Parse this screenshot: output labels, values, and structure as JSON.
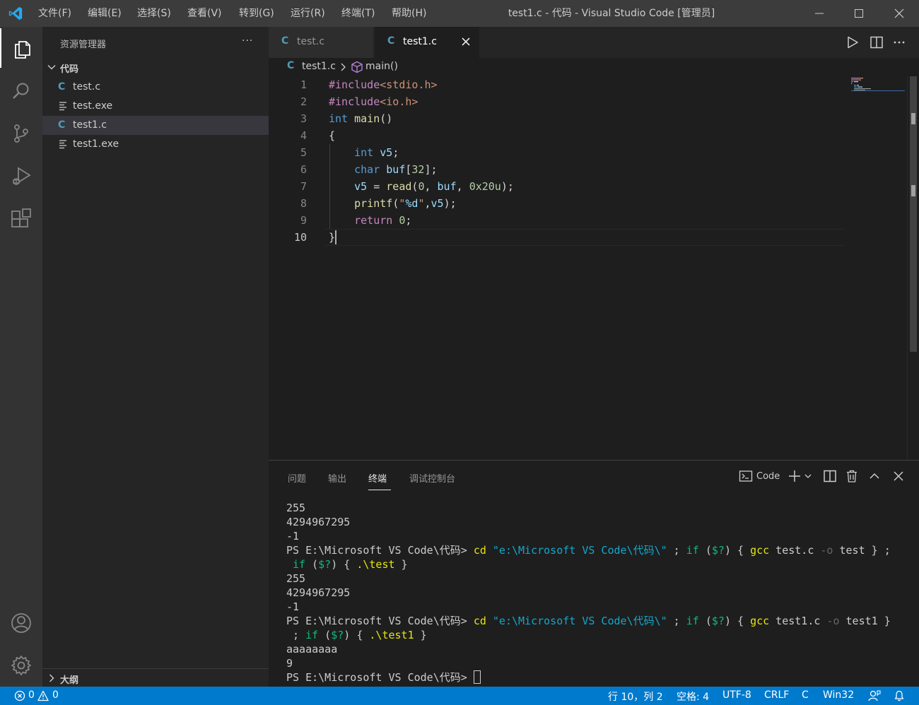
{
  "titlebar": {
    "menus": [
      "文件(F)",
      "编辑(E)",
      "选择(S)",
      "查看(V)",
      "转到(G)",
      "运行(R)",
      "终端(T)",
      "帮助(H)"
    ],
    "window_title": "test1.c - 代码 - Visual Studio Code [管理员]"
  },
  "sidebar": {
    "title": "资源管理器",
    "more": "···",
    "folder": "代码",
    "files": [
      {
        "name": "test.c",
        "icon": "c-file-icon",
        "icon_glyph": "C"
      },
      {
        "name": "test.exe",
        "icon": "exe-file-icon",
        "icon_glyph": ""
      },
      {
        "name": "test1.c",
        "icon": "c-file-icon",
        "icon_glyph": "C",
        "selected": true
      },
      {
        "name": "test1.exe",
        "icon": "exe-file-icon",
        "icon_glyph": ""
      }
    ],
    "outline": "大纲"
  },
  "tabs": [
    {
      "label": "test.c",
      "icon_glyph": "C",
      "active": false
    },
    {
      "label": "test1.c",
      "icon_glyph": "C",
      "active": true
    }
  ],
  "breadcrumb": {
    "icon_glyph": "C",
    "file": "test1.c",
    "symbol": "main()"
  },
  "editor": {
    "active_line": 10,
    "lines": [
      {
        "n": "1",
        "tokens": [
          {
            "t": "#include",
            "c": "pp"
          },
          {
            "t": "<stdio.h>",
            "c": "inc"
          }
        ]
      },
      {
        "n": "2",
        "tokens": [
          {
            "t": "#include",
            "c": "pp"
          },
          {
            "t": "<io.h>",
            "c": "inc"
          }
        ]
      },
      {
        "n": "3",
        "tokens": [
          {
            "t": "int",
            "c": "kw"
          },
          {
            "t": " ",
            "c": "pun"
          },
          {
            "t": "main",
            "c": "fn"
          },
          {
            "t": "()",
            "c": "pun"
          }
        ]
      },
      {
        "n": "4",
        "tokens": [
          {
            "t": "{",
            "c": "pun"
          }
        ]
      },
      {
        "n": "5",
        "tokens": [
          {
            "t": "    ",
            "c": "pun"
          },
          {
            "t": "int",
            "c": "kw"
          },
          {
            "t": " ",
            "c": "pun"
          },
          {
            "t": "v5",
            "c": "var"
          },
          {
            "t": ";",
            "c": "pun"
          }
        ]
      },
      {
        "n": "6",
        "tokens": [
          {
            "t": "    ",
            "c": "pun"
          },
          {
            "t": "char",
            "c": "kw"
          },
          {
            "t": " ",
            "c": "pun"
          },
          {
            "t": "buf",
            "c": "var"
          },
          {
            "t": "[",
            "c": "pun"
          },
          {
            "t": "32",
            "c": "num"
          },
          {
            "t": "];",
            "c": "pun"
          }
        ]
      },
      {
        "n": "7",
        "tokens": [
          {
            "t": "    ",
            "c": "pun"
          },
          {
            "t": "v5",
            "c": "var"
          },
          {
            "t": " = ",
            "c": "pun"
          },
          {
            "t": "read",
            "c": "fn"
          },
          {
            "t": "(",
            "c": "pun"
          },
          {
            "t": "0",
            "c": "num"
          },
          {
            "t": ", ",
            "c": "pun"
          },
          {
            "t": "buf",
            "c": "var"
          },
          {
            "t": ", ",
            "c": "pun"
          },
          {
            "t": "0x20u",
            "c": "num"
          },
          {
            "t": ");",
            "c": "pun"
          }
        ]
      },
      {
        "n": "8",
        "tokens": [
          {
            "t": "    ",
            "c": "pun"
          },
          {
            "t": "printf",
            "c": "fn"
          },
          {
            "t": "(",
            "c": "pun"
          },
          {
            "t": "\"",
            "c": "str"
          },
          {
            "t": "%d",
            "c": "esc"
          },
          {
            "t": "\"",
            "c": "str"
          },
          {
            "t": ",",
            "c": "pun"
          },
          {
            "t": "v5",
            "c": "var"
          },
          {
            "t": ");",
            "c": "pun"
          }
        ]
      },
      {
        "n": "9",
        "tokens": [
          {
            "t": "    ",
            "c": "pun"
          },
          {
            "t": "return",
            "c": "pp"
          },
          {
            "t": " ",
            "c": "pun"
          },
          {
            "t": "0",
            "c": "num"
          },
          {
            "t": ";",
            "c": "pun"
          }
        ]
      },
      {
        "n": "10",
        "tokens": [
          {
            "t": "}",
            "c": "pun"
          }
        ]
      }
    ]
  },
  "panel": {
    "tabs": [
      "问题",
      "输出",
      "终端",
      "调试控制台"
    ],
    "active_tab": "终端",
    "terminal_select": "Code",
    "terminal_lines": [
      [
        {
          "t": "255",
          "c": ""
        }
      ],
      [
        {
          "t": "4294967295",
          "c": ""
        }
      ],
      [
        {
          "t": "-1",
          "c": ""
        }
      ],
      [
        {
          "t": "PS E:\\Microsoft VS Code\\代码> ",
          "c": ""
        },
        {
          "t": "cd",
          "c": "t-y"
        },
        {
          "t": " ",
          "c": ""
        },
        {
          "t": "\"e:\\Microsoft VS Code\\代码\\\"",
          "c": "t-c"
        },
        {
          "t": " ; ",
          "c": ""
        },
        {
          "t": "if",
          "c": "t-g"
        },
        {
          "t": " (",
          "c": ""
        },
        {
          "t": "$?",
          "c": "t-g"
        },
        {
          "t": ") { ",
          "c": ""
        },
        {
          "t": "gcc",
          "c": "t-y"
        },
        {
          "t": " test.c ",
          "c": ""
        },
        {
          "t": "-o",
          "c": "t-d"
        },
        {
          "t": " test } ;",
          "c": ""
        }
      ],
      [
        {
          "t": " ",
          "c": ""
        },
        {
          "t": "if",
          "c": "t-g"
        },
        {
          "t": " (",
          "c": ""
        },
        {
          "t": "$?",
          "c": "t-g"
        },
        {
          "t": ") { ",
          "c": ""
        },
        {
          "t": ".\\test",
          "c": "t-y"
        },
        {
          "t": " }",
          "c": ""
        }
      ],
      [
        {
          "t": "255",
          "c": ""
        }
      ],
      [
        {
          "t": "4294967295",
          "c": ""
        }
      ],
      [
        {
          "t": "-1",
          "c": ""
        }
      ],
      [
        {
          "t": "PS E:\\Microsoft VS Code\\代码> ",
          "c": ""
        },
        {
          "t": "cd",
          "c": "t-y"
        },
        {
          "t": " ",
          "c": ""
        },
        {
          "t": "\"e:\\Microsoft VS Code\\代码\\\"",
          "c": "t-c"
        },
        {
          "t": " ; ",
          "c": ""
        },
        {
          "t": "if",
          "c": "t-g"
        },
        {
          "t": " (",
          "c": ""
        },
        {
          "t": "$?",
          "c": "t-g"
        },
        {
          "t": ") { ",
          "c": ""
        },
        {
          "t": "gcc",
          "c": "t-y"
        },
        {
          "t": " test1.c ",
          "c": ""
        },
        {
          "t": "-o",
          "c": "t-d"
        },
        {
          "t": " test1 }",
          "c": ""
        }
      ],
      [
        {
          "t": " ; ",
          "c": ""
        },
        {
          "t": "if",
          "c": "t-g"
        },
        {
          "t": " (",
          "c": ""
        },
        {
          "t": "$?",
          "c": "t-g"
        },
        {
          "t": ") { ",
          "c": ""
        },
        {
          "t": ".\\test1",
          "c": "t-y"
        },
        {
          "t": " }",
          "c": ""
        }
      ],
      [
        {
          "t": "aaaaaaaa",
          "c": ""
        }
      ],
      [
        {
          "t": "9",
          "c": ""
        }
      ],
      [
        {
          "t": "PS E:\\Microsoft VS Code\\代码> ",
          "c": ""
        }
      ]
    ]
  },
  "statusbar": {
    "errors": "0",
    "warnings": "0",
    "position": "行 10，列 2",
    "indent": "空格: 4",
    "encoding": "UTF-8",
    "eol": "CRLF",
    "language": "C",
    "config": "Win32"
  },
  "colors": {
    "accent": "#007acc",
    "titlebar": "#3c3c3c",
    "activitybar": "#333333",
    "sidebar": "#252526",
    "editor": "#1e1e1e"
  }
}
